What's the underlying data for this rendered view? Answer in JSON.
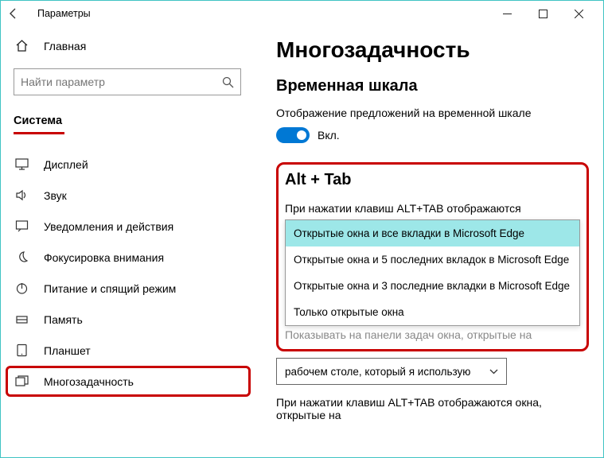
{
  "titlebar": {
    "title": "Параметры"
  },
  "sidebar": {
    "home_label": "Главная",
    "search_placeholder": "Найти параметр",
    "section_label": "Система",
    "items": [
      {
        "label": "Дисплей"
      },
      {
        "label": "Звук"
      },
      {
        "label": "Уведомления и действия"
      },
      {
        "label": "Фокусировка внимания"
      },
      {
        "label": "Питание и спящий режим"
      },
      {
        "label": "Память"
      },
      {
        "label": "Планшет"
      },
      {
        "label": "Многозадачность"
      }
    ]
  },
  "main": {
    "page_title": "Многозадачность",
    "timeline_section": {
      "title": "Временная шкала",
      "label": "Отображение предложений на временной шкале",
      "toggle_text": "Вкл."
    },
    "alttab_section": {
      "title": "Alt + Tab",
      "dropdown_label": "При нажатии клавиш ALT+TAB отображаются",
      "options": [
        "Открытые окна и все вкладки в Microsoft Edge",
        "Открытые окна и 5 последних вкладок в Microsoft Edge",
        "Открытые окна и 3 последние вкладки в Microsoft Edge",
        "Только открытые окна"
      ],
      "below_label": "Показывать на панели задач окна, открытые на",
      "select_value": "рабочем столе, который я использую",
      "label2": "При нажатии клавиш ALT+TAB отображаются окна, открытые на"
    }
  }
}
